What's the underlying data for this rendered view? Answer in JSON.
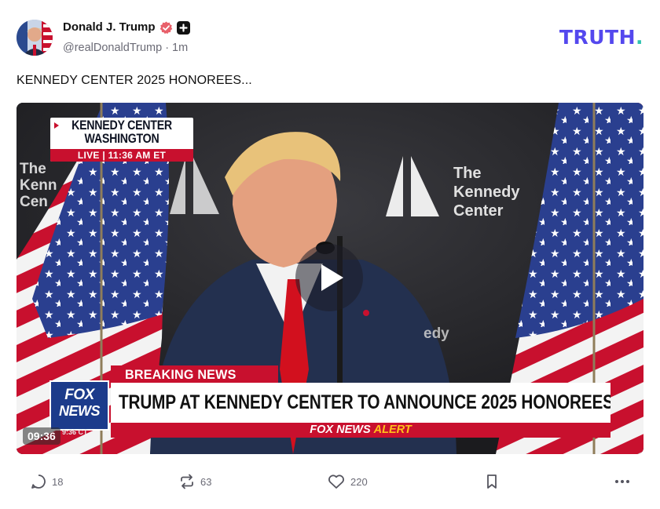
{
  "author": {
    "name": "Donald J. Trump",
    "handle": "@realDonaldTrump",
    "time": "1m"
  },
  "brand": {
    "logo_text": "TRUTH",
    "logo_dot": ".",
    "logo_color": "#5448EE",
    "dot_color": "#30C3B0"
  },
  "post": {
    "text": "KENNEDY CENTER 2025 HONOREES..."
  },
  "video": {
    "duration": "09:36",
    "location_line1": "KENNEDY CENTER",
    "location_line2": "WASHINGTON",
    "live_text": "LIVE | 11:36 AM ET",
    "venue_left": "The\nKenn\nCen",
    "venue_right": "The\nKennedy\nCenter",
    "venue_partial": "edy",
    "breaking_label": "BREAKING NEWS",
    "headline": "TRUMP AT KENNEDY CENTER TO ANNOUNCE 2025 HONOREES",
    "alert_source": "FOX NEWS",
    "alert_word": "ALERT",
    "network_logo_line1": "FOX",
    "network_logo_line2": "NEWS",
    "network_time": "9:36 CT",
    "accent_red": "#C8102E",
    "accent_yellow": "#FFC21A"
  },
  "actions": {
    "replies": "18",
    "reposts": "63",
    "likes": "220"
  }
}
